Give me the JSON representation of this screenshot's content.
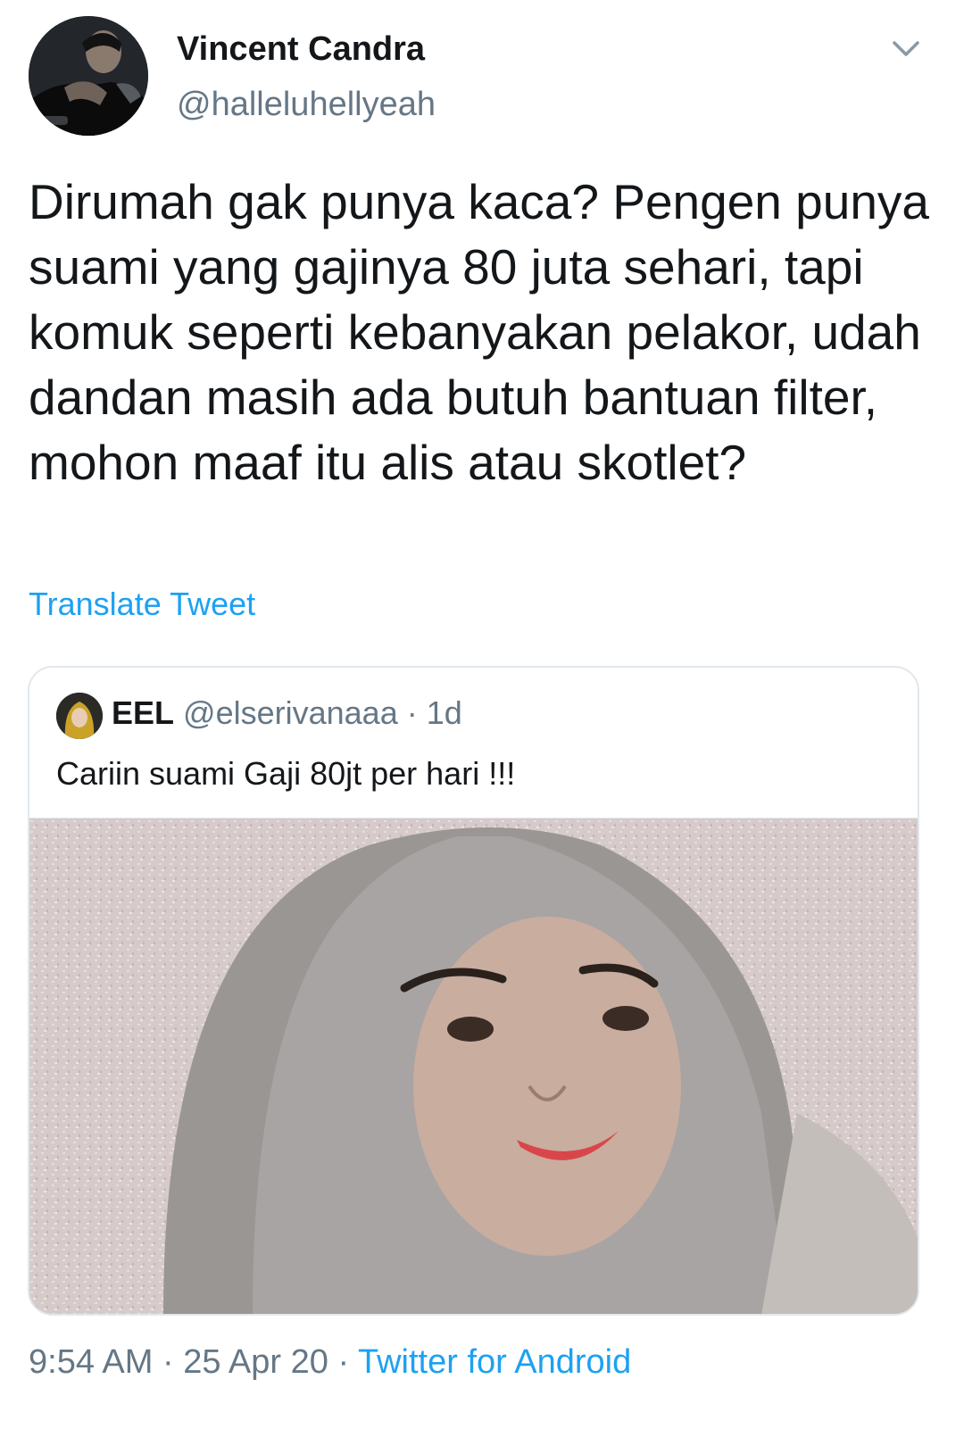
{
  "tweet": {
    "author": {
      "display_name": "Vincent Candra",
      "handle": "@halleluhellyeah",
      "avatar_icon": "profile-photo"
    },
    "menu_icon": "chevron-down-icon",
    "text": "Dirumah gak punya kaca? Pengen punya suami yang gajinya 80 juta sehari, tapi komuk seperti kebanyakan pelakor, udah dandan masih ada butuh bantuan filter, mohon maaf itu alis atau skotlet?",
    "translate_label": "Translate Tweet",
    "quoted": {
      "display_name": "EEL",
      "handle": "@elserivanaaa",
      "separator": "·",
      "age": "1d",
      "text": "Cariin suami Gaji 80jt per hari !!!",
      "media_icon": "photo-image"
    },
    "footer": {
      "time": "9:54 AM",
      "separator": "·",
      "date": "25 Apr 20",
      "source": "Twitter for Android"
    }
  },
  "colors": {
    "accent": "#1da1f2",
    "text": "#14171a",
    "muted": "#657786",
    "border": "#e1e8ed"
  }
}
